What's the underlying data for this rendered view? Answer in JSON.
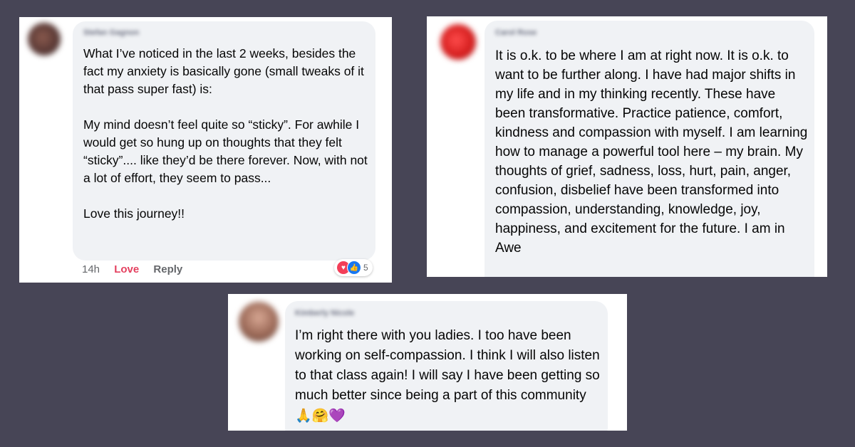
{
  "comments": [
    {
      "author": "Stefan Gagnon",
      "text": "What I’ve noticed in the last 2 weeks, besides the fact my anxiety is basically gone (small tweaks of it that pass super fast) is:\n\nMy mind doesn’t feel quite so “sticky”.  For awhile I would get so hung up on thoughts that they felt “sticky”....  like they’d be there forever.  Now, with not a lot of effort, they seem to pass...\n\nLove this journey!!",
      "time": "14h",
      "love_label": "Love",
      "reply_label": "Reply",
      "reaction_count": "5",
      "reaction_icons": [
        "heart-icon",
        "like-icon"
      ]
    },
    {
      "author": "Carol Rose",
      "text": "It is o.k. to be where I am at right now.  It is o.k. to want to be further along.  I have had major shifts in my life and in my thinking recently.  These have been transformative.  Practice patience, comfort, kindness and compassion with myself.  I am learning how to manage a powerful tool here – my brain.  My thoughts of grief, sadness, loss, hurt, pain, anger, confusion, disbelief have been transformed into compassion, understanding, knowledge, joy, happiness, and excitement for the future.  I am in Awe"
    },
    {
      "author": "Kimberly Nicole",
      "text": "I’m right there with you ladies. I too have been working on self-compassion. I think I will also listen to that class again! I will say I have been getting so much better since being a part of this community",
      "emojis": "🙏🤗💜"
    }
  ],
  "colors": {
    "background": "#474556",
    "bubble": "#f0f2f5",
    "love": "#e4405f",
    "meta": "#65676b"
  }
}
